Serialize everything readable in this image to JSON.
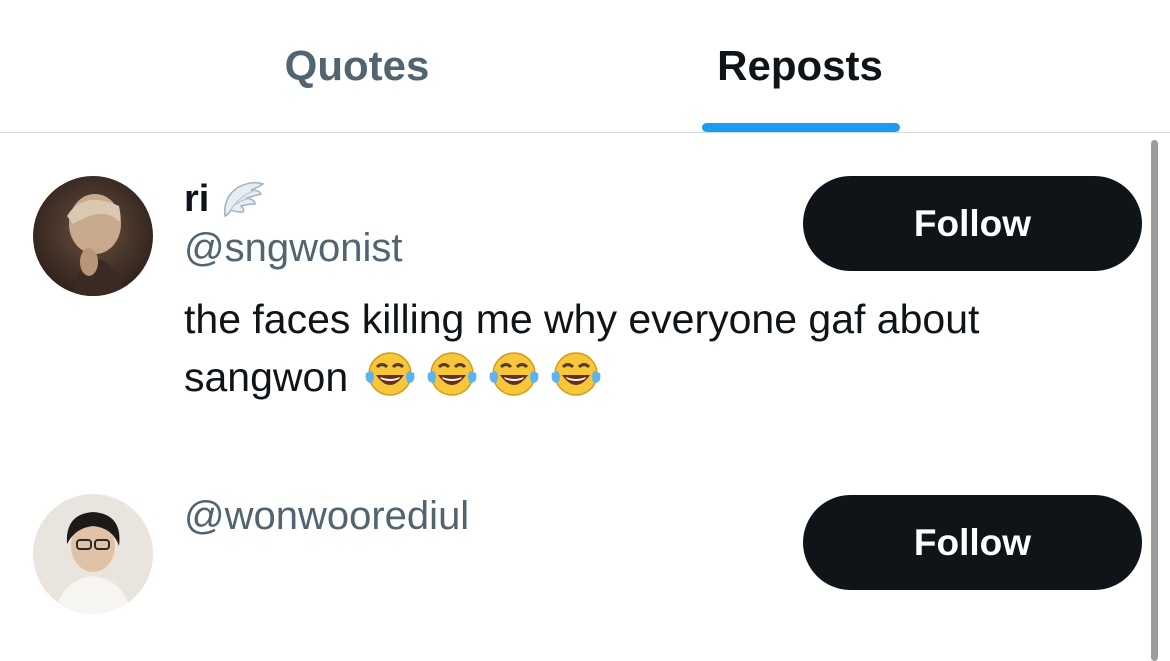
{
  "tabs": [
    {
      "label": "Quotes",
      "active": false
    },
    {
      "label": "Reposts",
      "active": true
    }
  ],
  "accent_color": "#1d9bf0",
  "users": [
    {
      "display_name": "ri",
      "name_emoji": "wing-icon",
      "handle": "@sngwonist",
      "bio": "the faces killing me why everyone gaf about sangwon",
      "bio_emojis": [
        "laughing-tears-icon",
        "laughing-tears-icon",
        "laughing-tears-icon",
        "laughing-tears-icon"
      ],
      "follow_label": "Follow"
    },
    {
      "display_name": "",
      "handle": "@wonwoorediul",
      "bio": "",
      "follow_label": "Follow"
    }
  ]
}
